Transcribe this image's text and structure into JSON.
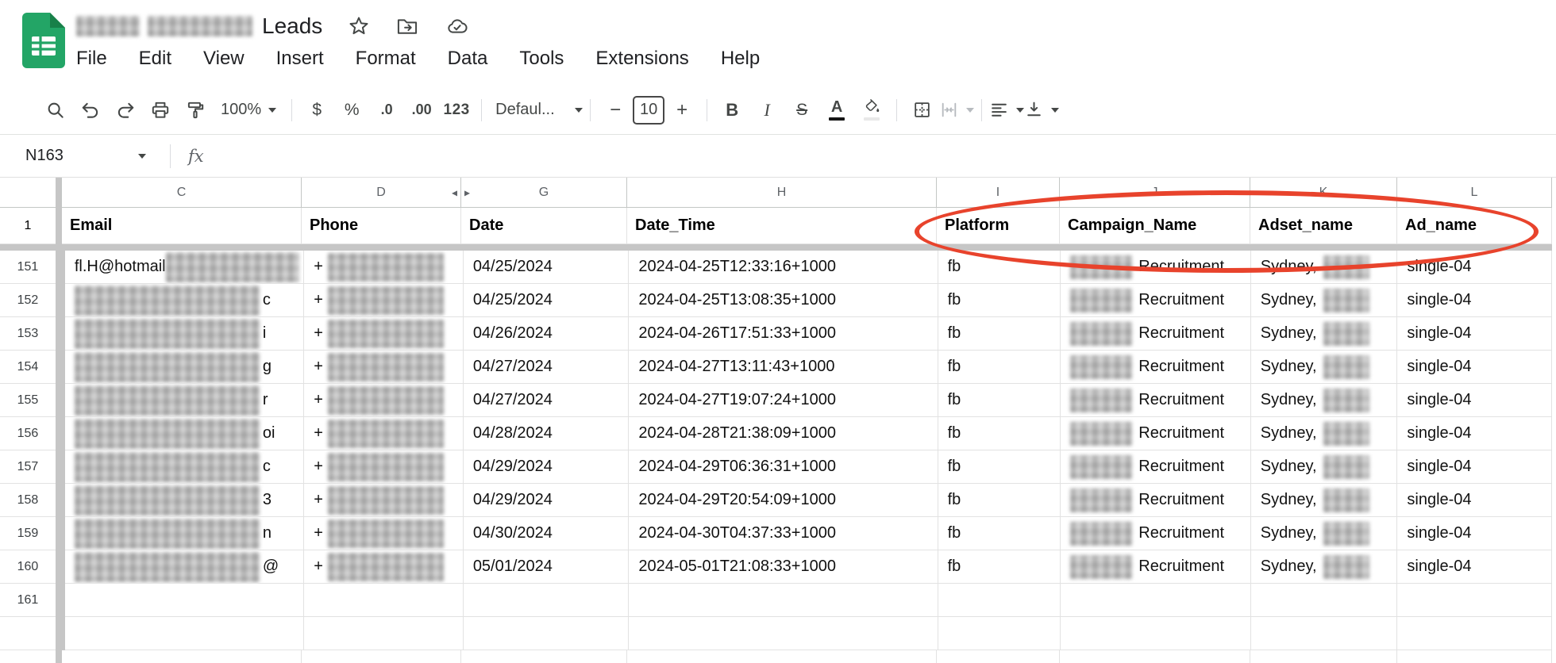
{
  "header": {
    "title": "Leads",
    "menu": [
      "File",
      "Edit",
      "View",
      "Insert",
      "Format",
      "Data",
      "Tools",
      "Extensions",
      "Help"
    ]
  },
  "toolbar": {
    "zoom": "100%",
    "currency": "$",
    "percent": "%",
    "decimal_decrease": ".0",
    "decimal_increase": ".00",
    "number_format": "123",
    "font_name": "Defaul...",
    "minus": "−",
    "font_size": "10",
    "plus": "+",
    "bold": "B",
    "italic": "I",
    "strikethrough": "S",
    "text_color": "A"
  },
  "formula_bar": {
    "cell_reference": "N163",
    "fx_label": "fx"
  },
  "icons": {
    "hidden_col_left": "◂",
    "hidden_col_right": "▸"
  },
  "sheet": {
    "column_letters": [
      "C",
      "D",
      "G",
      "H",
      "I",
      "J",
      "K",
      "L"
    ],
    "header_row": {
      "num": "1",
      "email": "Email",
      "phone": "Phone",
      "date": "Date",
      "datetime": "Date_Time",
      "platform": "Platform",
      "campaign": "Campaign_Name",
      "adset": "Adset_name",
      "ad": "Ad_name"
    },
    "phone_prefix": "+",
    "rows": [
      {
        "num": "151",
        "email_start": "fl.H@hotmail",
        "email_end": "",
        "date": "04/25/2024",
        "datetime": "2024-04-25T12:33:16+1000",
        "platform": "fb",
        "campaign": "Recruitment",
        "adset": "Sydney,",
        "ad": "single-04"
      },
      {
        "num": "152",
        "email_start": "",
        "email_end": "c",
        "date": "04/25/2024",
        "datetime": "2024-04-25T13:08:35+1000",
        "platform": "fb",
        "campaign": "Recruitment",
        "adset": "Sydney,",
        "ad": "single-04"
      },
      {
        "num": "153",
        "email_start": "",
        "email_end": "i",
        "date": "04/26/2024",
        "datetime": "2024-04-26T17:51:33+1000",
        "platform": "fb",
        "campaign": "Recruitment",
        "adset": "Sydney,",
        "ad": "single-04"
      },
      {
        "num": "154",
        "email_start": "",
        "email_end": "g",
        "date": "04/27/2024",
        "datetime": "2024-04-27T13:11:43+1000",
        "platform": "fb",
        "campaign": "Recruitment",
        "adset": "Sydney,",
        "ad": "single-04"
      },
      {
        "num": "155",
        "email_start": "",
        "email_end": "r",
        "date": "04/27/2024",
        "datetime": "2024-04-27T19:07:24+1000",
        "platform": "fb",
        "campaign": "Recruitment",
        "adset": "Sydney,",
        "ad": "single-04"
      },
      {
        "num": "156",
        "email_start": "",
        "email_end": "oi",
        "date": "04/28/2024",
        "datetime": "2024-04-28T21:38:09+1000",
        "platform": "fb",
        "campaign": "Recruitment",
        "adset": "Sydney,",
        "ad": "single-04"
      },
      {
        "num": "157",
        "email_start": "",
        "email_end": "c",
        "date": "04/29/2024",
        "datetime": "2024-04-29T06:36:31+1000",
        "platform": "fb",
        "campaign": "Recruitment",
        "adset": "Sydney,",
        "ad": "single-04"
      },
      {
        "num": "158",
        "email_start": "",
        "email_end": "3",
        "date": "04/29/2024",
        "datetime": "2024-04-29T20:54:09+1000",
        "platform": "fb",
        "campaign": "Recruitment",
        "adset": "Sydney,",
        "ad": "single-04"
      },
      {
        "num": "159",
        "email_start": "",
        "email_end": "n",
        "date": "04/30/2024",
        "datetime": "2024-04-30T04:37:33+1000",
        "platform": "fb",
        "campaign": "Recruitment",
        "adset": "Sydney,",
        "ad": "single-04"
      },
      {
        "num": "160",
        "email_start": "",
        "email_end": "@",
        "date": "05/01/2024",
        "datetime": "2024-05-01T21:08:33+1000",
        "platform": "fb",
        "campaign": "Recruitment",
        "adset": "Sydney,",
        "ad": "single-04"
      }
    ],
    "next_row_number": "161"
  },
  "annotation": {
    "color": "#e8432c"
  }
}
